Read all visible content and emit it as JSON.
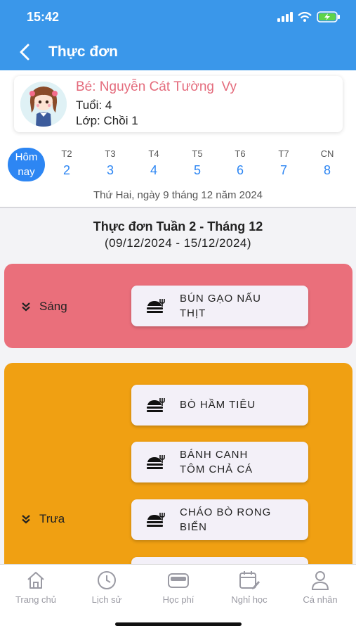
{
  "status_bar": {
    "time": "15:42"
  },
  "header": {
    "title": "Thực đơn"
  },
  "child": {
    "name": "Bé: Nguyễn Cát Tường  Vy",
    "age": "Tuổi: 4",
    "class": "Lớp: Chồi 1"
  },
  "week_nav": {
    "today_line1": "Hôm",
    "today_line2": "nay",
    "days": [
      {
        "label": "T2",
        "num": "2"
      },
      {
        "label": "T3",
        "num": "3"
      },
      {
        "label": "T4",
        "num": "4"
      },
      {
        "label": "T5",
        "num": "5"
      },
      {
        "label": "T6",
        "num": "6"
      },
      {
        "label": "T7",
        "num": "7"
      },
      {
        "label": "CN",
        "num": "8"
      }
    ],
    "selected_date": "Thứ Hai, ngày 9 tháng 12 năm 2024"
  },
  "menu": {
    "title": "Thực đơn Tuần 2 - Tháng 12",
    "range": "(09/12/2024 - 15/12/2024)",
    "morning": {
      "label": "Sáng",
      "color": "#ea6f7b",
      "dishes": [
        {
          "line1": "BÚN GẠO NẤU",
          "line2": "THỊT"
        }
      ]
    },
    "noon": {
      "label": "Trưa",
      "color": "#f0a012",
      "dishes": [
        {
          "line1": "BÒ HẦM TIÊU",
          "line2": ""
        },
        {
          "line1": "BÁNH CANH",
          "line2": "TÔM CHẢ CÁ"
        },
        {
          "line1": "CHÁO BÒ RONG",
          "line2": "BIỂN"
        }
      ]
    }
  },
  "tabs": [
    {
      "label": "Trang chủ",
      "icon": "home-icon"
    },
    {
      "label": "Lịch sử",
      "icon": "clock-icon"
    },
    {
      "label": "Học phí",
      "icon": "wallet-icon"
    },
    {
      "label": "Nghỉ học",
      "icon": "calendar-edit-icon"
    },
    {
      "label": "Cá nhân",
      "icon": "person-icon"
    }
  ],
  "colors": {
    "header": "#3a97ea",
    "accent": "#2d86f3"
  }
}
